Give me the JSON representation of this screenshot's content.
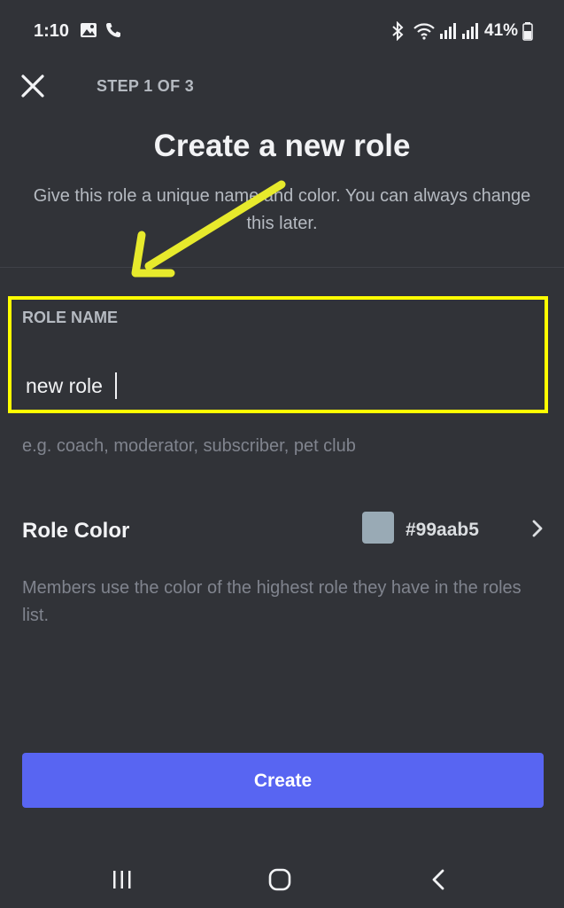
{
  "status_bar": {
    "time": "1:10",
    "battery": "41%"
  },
  "header": {
    "step": "STEP 1 OF 3"
  },
  "main": {
    "title": "Create a new role",
    "subtitle": "Give this role a unique name and color. You can always change this later.",
    "role_name": {
      "label": "ROLE NAME",
      "value": "new role",
      "helper": "e.g. coach, moderator, subscriber, pet club"
    },
    "role_color": {
      "label": "Role Color",
      "hex": "#99aab5",
      "swatch_color": "#99aab5",
      "description": "Members use the color of the highest role they have in the roles list."
    },
    "create_button": "Create"
  },
  "colors": {
    "background": "#313338",
    "accent": "#5865f2",
    "highlight": "#ffff00"
  },
  "icons": [
    "close-icon",
    "chevron-right-icon",
    "recent-apps-icon",
    "home-icon",
    "back-icon",
    "bluetooth-icon",
    "wifi-icon",
    "signal-icon",
    "battery-icon",
    "gallery-icon",
    "phone-icon"
  ]
}
